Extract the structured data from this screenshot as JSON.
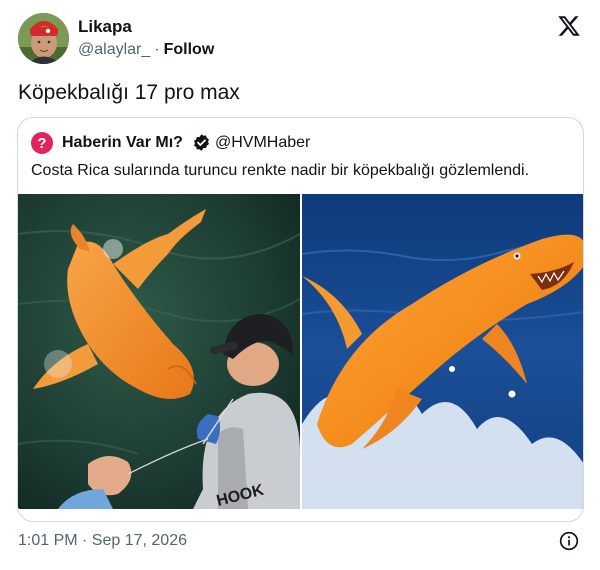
{
  "tweet": {
    "author": {
      "name": "Likapa",
      "handle": "@alaylar_",
      "separator": "·",
      "follow_label": "Follow"
    },
    "text": "Köpekbalığı 17 pro max",
    "timestamp": "1:01 PM · Sep 17, 2026"
  },
  "quoted_tweet": {
    "name": "Haberin Var Mı?",
    "handle": "@HVMHaber",
    "text": "Costa Rica sularında turuncu renkte nadir bir köpekbalığı gözlemlendi."
  },
  "icons": {
    "x_logo": "x-logo-icon",
    "question_badge": "question-mark-icon",
    "verified": "verified-badge-icon",
    "info": "info-icon"
  },
  "colors": {
    "text": "#0f1419",
    "secondary": "#536471",
    "border": "#cfd9de",
    "badge_red": "#e0245e",
    "shark_orange": "#f08a1e"
  }
}
